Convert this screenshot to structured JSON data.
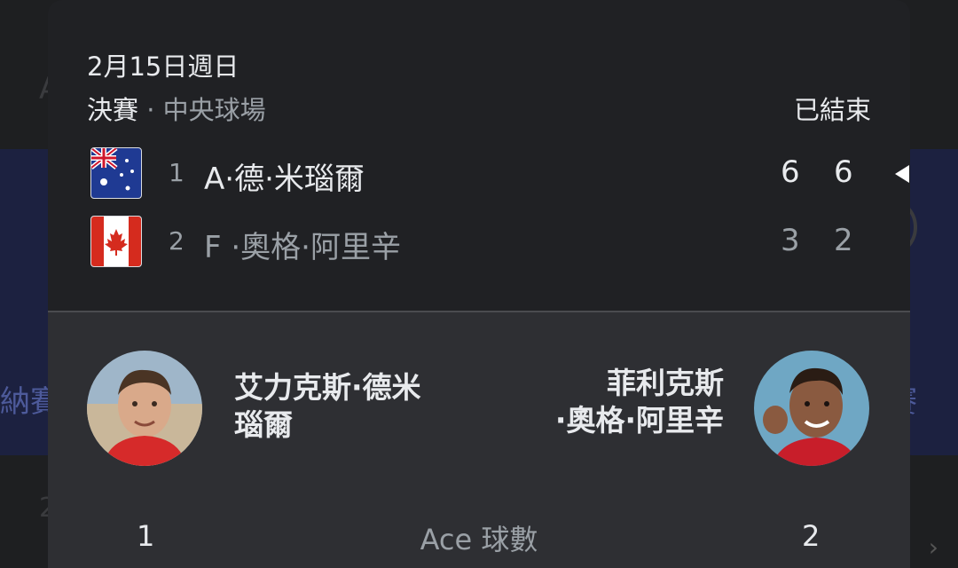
{
  "match": {
    "date": "2月15日週日",
    "round": "決賽",
    "separator": "·",
    "court": "中央球場",
    "status": "已結束"
  },
  "players": [
    {
      "seed": "1",
      "short_name": "A·德·米瑙爾",
      "full_name_line1": "艾力克斯·德米",
      "full_name_line2": "瑙爾",
      "flag": "australia-flag",
      "scores": [
        "6",
        "6"
      ],
      "winner": true
    },
    {
      "seed": "2",
      "short_name": "F ·奧格·阿里辛",
      "full_name_line1": "菲利克斯",
      "full_name_line2": "·奧格·阿里辛",
      "flag": "canada-flag",
      "scores": [
        "3",
        "2"
      ],
      "winner": false
    }
  ],
  "stats": [
    {
      "label": "Ace 球數",
      "left": "1",
      "right": "2"
    }
  ],
  "colors": {
    "card_top": "#202124",
    "card_bottom": "#2e2f33",
    "text_primary": "#e8eaed",
    "text_secondary": "#9aa0a6"
  }
}
